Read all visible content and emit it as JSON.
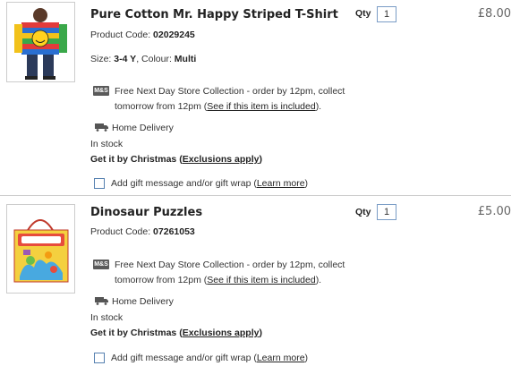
{
  "items": [
    {
      "title": "Pure Cotton Mr. Happy Striped T-Shirt",
      "product_code_label": "Product Code:",
      "product_code": "02029245",
      "size_label": "Size:",
      "size": "3-4 Y",
      "colour_label": ", Colour:",
      "colour": "Multi",
      "qty_label": "Qty",
      "qty": "1",
      "price": "£8.00",
      "collection_text_1": "Free Next Day Store Collection - order by 12pm, collect",
      "collection_text_2": "tomorrow from 12pm (",
      "collection_link": "See if this item is included",
      "collection_text_3": ").",
      "store_icon": "M&S",
      "home_delivery": "Home Delivery",
      "stock": "In stock",
      "christmas_text": "Get it by Christmas (",
      "exclusions_link": "Exclusions apply",
      "christmas_end": ")",
      "gift_text": "Add gift message and/or gift wrap (",
      "learn_more": "Learn more",
      "gift_end": ")"
    },
    {
      "title": "Dinosaur Puzzles",
      "product_code_label": "Product Code:",
      "product_code": "07261053",
      "qty_label": "Qty",
      "qty": "1",
      "price": "£5.00",
      "collection_text_1": "Free Next Day Store Collection - order by 12pm, collect",
      "collection_text_2": "tomorrow from 12pm (",
      "collection_link": "See if this item is included",
      "collection_text_3": ").",
      "store_icon": "M&S",
      "home_delivery": "Home Delivery",
      "stock": "In stock",
      "christmas_text": "Get it by Christmas (",
      "exclusions_link": "Exclusions apply",
      "christmas_end": ")",
      "gift_text": "Add gift message and/or gift wrap (",
      "learn_more": "Learn more",
      "gift_end": ")"
    }
  ],
  "colors": {
    "border": "#cccccc",
    "checkbox": "#5580b0",
    "price": "#666666"
  }
}
